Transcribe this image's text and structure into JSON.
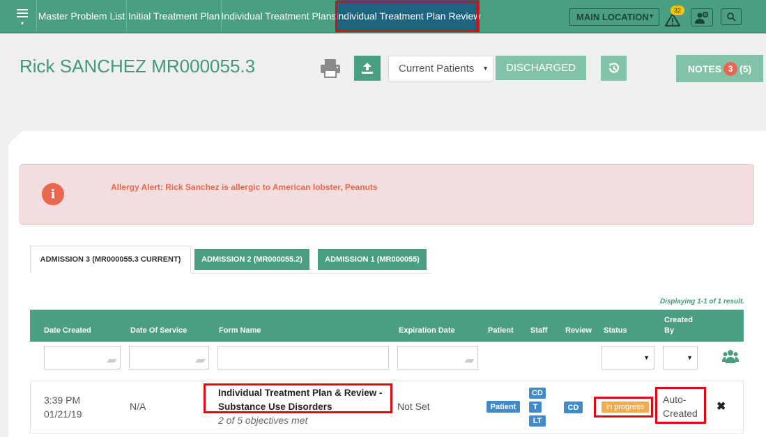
{
  "nav": {
    "tabs": [
      "Master Problem List",
      "Initial Treatment Plan",
      "Individual Treatment Plans",
      "Individual Treatment Plan Review"
    ],
    "location": "MAIN LOCATION",
    "alert_count": "32"
  },
  "header": {
    "patient_name": "Rick SANCHEZ MR000055.3",
    "patients_filter": "Current Patients",
    "discharged_label": "DISCHARGED",
    "notes_label": "NOTES",
    "notes_count": "3",
    "notes_total": "(5)"
  },
  "allergy": {
    "text": "Allergy Alert: Rick Sanchez is allergic to American lobster, Peanuts"
  },
  "admissions": [
    "ADMISSION 3 (MR000055.3 CURRENT)",
    "ADMISSION 2 (MR000055.2)",
    "ADMISSION 1 (MR000055)"
  ],
  "table": {
    "displaying": "Displaying 1-1 of 1 result.",
    "columns": [
      "Date Created",
      "Date Of Service",
      "Form Name",
      "Expiration Date",
      "Patient",
      "Staff",
      "Review",
      "Status",
      "Created",
      "By"
    ],
    "row": {
      "time": "3:39 PM",
      "date": "01/21/19",
      "service": "N/A",
      "form_name_1": "Individual Treatment Plan & Review -",
      "form_name_2": "Substance Use Disorders",
      "objectives": "2 of 5 objectives met",
      "expiration": "Not Set",
      "patient": "Patient",
      "staff": [
        "CD",
        "T",
        "LT"
      ],
      "review": "CD",
      "status": "in progress",
      "created_by_1": "Auto-",
      "created_by_2": "Created"
    }
  },
  "colors": {
    "brand": "#4a9f80",
    "active_tab": "#1e6480",
    "highlight": "#e30613",
    "label_blue": "#428bca",
    "label_warning": "#f0ad4e"
  },
  "icons": [
    "hamburger-icon",
    "alert-icon",
    "gear-user-icon",
    "search-icon",
    "print-icon",
    "upload-icon",
    "history-icon",
    "info-icon",
    "group-icon",
    "delete-icon"
  ]
}
